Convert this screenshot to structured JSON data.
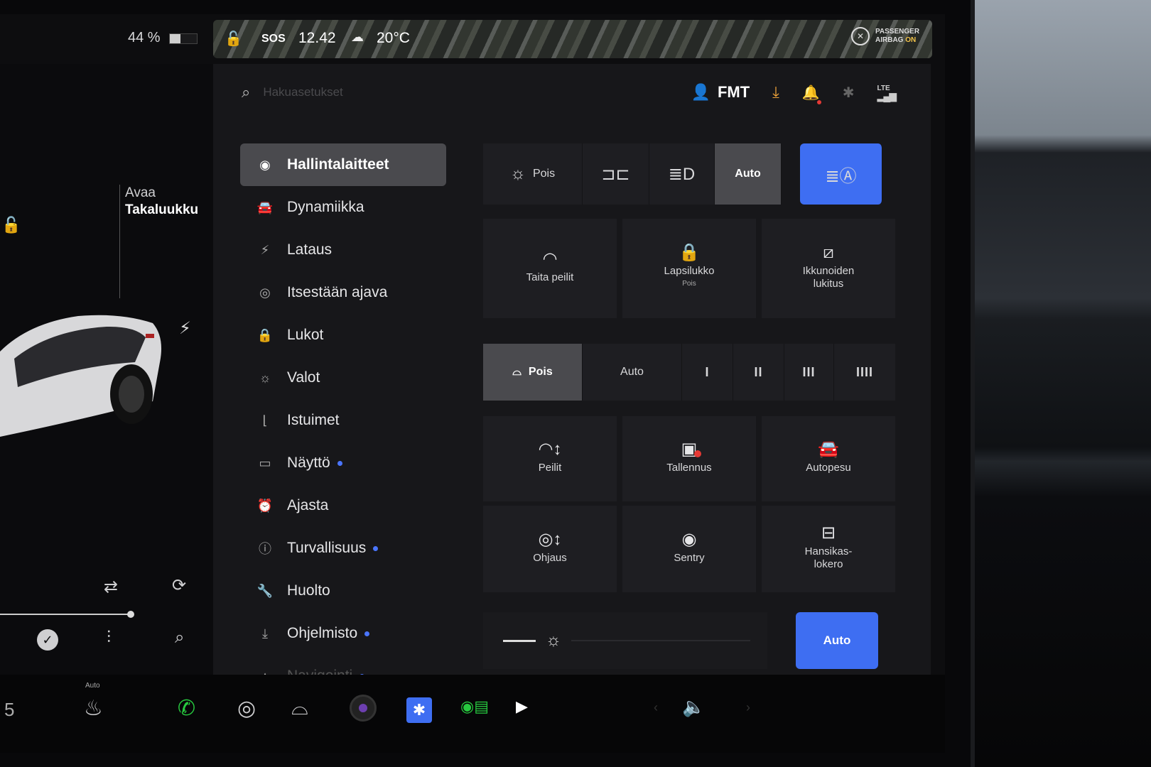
{
  "status": {
    "battery": "44 %",
    "sos": "SOS",
    "time": "12.42",
    "temperature": "20°C",
    "airbag_line1": "PASSENGER",
    "airbag_line2": "AIRBAG",
    "airbag_state": "ON",
    "network": "LTE"
  },
  "left_panel": {
    "trunk_action": "Avaa",
    "trunk_name": "Takaluukku"
  },
  "search": {
    "placeholder": "Hakuasetukset"
  },
  "profile": {
    "name": "FMT"
  },
  "nav": {
    "items": [
      {
        "label": "Hallintalaitteet",
        "icon": "toggle-icon"
      },
      {
        "label": "Dynamiikka",
        "icon": "car-icon"
      },
      {
        "label": "Lataus",
        "icon": "bolt-icon"
      },
      {
        "label": "Itsestään ajava",
        "icon": "steering-wheel-icon"
      },
      {
        "label": "Lukot",
        "icon": "lock-icon"
      },
      {
        "label": "Valot",
        "icon": "sun-icon"
      },
      {
        "label": "Istuimet",
        "icon": "seat-icon"
      },
      {
        "label": "Näyttö",
        "icon": "display-icon"
      },
      {
        "label": "Ajasta",
        "icon": "alarm-clock-icon"
      },
      {
        "label": "Turvallisuus",
        "icon": "info-circle-icon"
      },
      {
        "label": "Huolto",
        "icon": "wrench-icon"
      },
      {
        "label": "Ohjelmisto",
        "icon": "download-icon"
      },
      {
        "label": "Navigointi",
        "icon": "navigation-icon"
      }
    ]
  },
  "lights": {
    "off_label": "Pois",
    "auto_label": "Auto"
  },
  "tiles_row1": {
    "fold_mirrors": "Taita peilit",
    "child_lock": "Lapsilukko",
    "child_lock_state": "Pois",
    "window_lock_line1": "Ikkunoiden",
    "window_lock_line2": "lukitus"
  },
  "wipers": {
    "off_label": "Pois",
    "auto_label": "Auto",
    "levels": [
      "I",
      "II",
      "III",
      "IIII"
    ]
  },
  "tiles_row2": {
    "mirrors": "Peilit",
    "recording": "Tallennus",
    "car_wash": "Autopesu"
  },
  "tiles_row3": {
    "steering": "Ohjaus",
    "sentry": "Sentry",
    "glovebox_line1": "Hansikas-",
    "glovebox_line2": "lokero"
  },
  "display": {
    "auto_label": "Auto"
  },
  "taskbar": {
    "temp": "5",
    "seat_heat_mode": "Auto"
  },
  "colors": {
    "accent_blue": "#3e6ef2",
    "download_orange": "#f0a43a",
    "phone_green": "#27c93f"
  }
}
